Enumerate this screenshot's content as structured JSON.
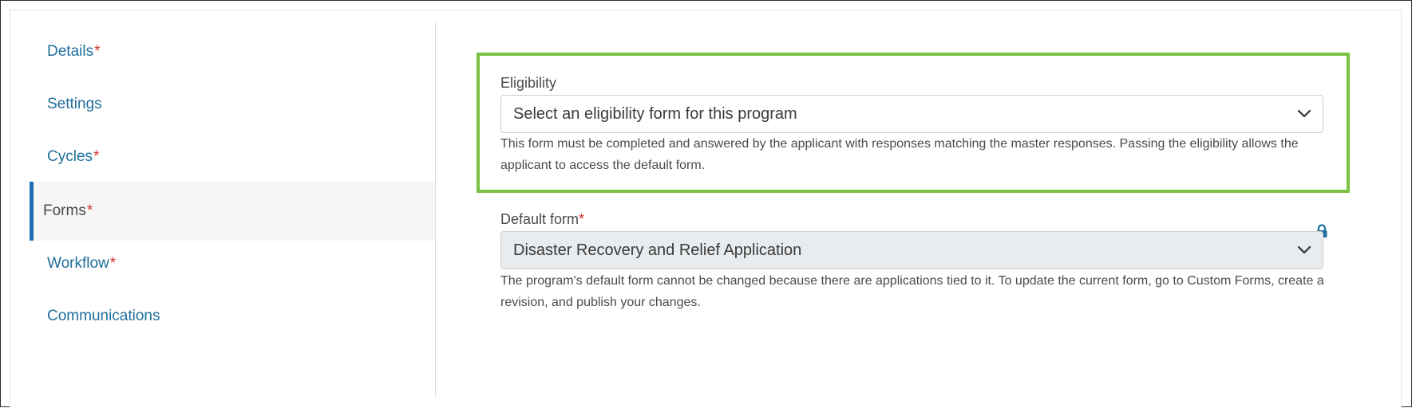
{
  "sidebar": {
    "items": [
      {
        "label": "Details",
        "required": "*"
      },
      {
        "label": "Settings",
        "required": ""
      },
      {
        "label": "Cycles",
        "required": "*"
      },
      {
        "label": "Forms",
        "required": "*"
      },
      {
        "label": "Workflow",
        "required": "*"
      },
      {
        "label": "Communications",
        "required": ""
      }
    ],
    "active": "Forms"
  },
  "eligibility": {
    "label": "Eligibility",
    "selected": "Select an eligibility form for this program",
    "help": "This form must be completed and answered by the applicant with responses matching the master responses. Passing the eligibility allows the applicant to access the default form."
  },
  "default_form": {
    "label": "Default form",
    "required": "*",
    "selected": "Disaster Recovery and Relief Application",
    "help": "The program's default form cannot be changed because there are applications tied to it. To update the current form, go to Custom Forms, create a revision, and publish your changes."
  },
  "colors": {
    "link": "#1f6f9c",
    "required": "#d0312d",
    "highlight": "#7cc242",
    "active_indicator": "#1f6fb2",
    "lock": "#1f6f9c"
  },
  "icons": {
    "dropdown": "chevron-down-icon",
    "locked": "lock-icon"
  }
}
